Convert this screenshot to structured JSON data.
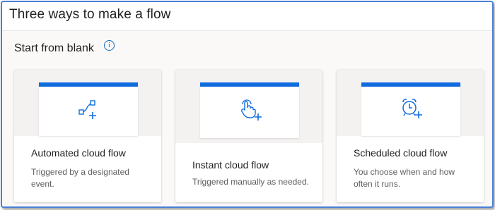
{
  "header": {
    "title": "Three ways to make a flow"
  },
  "section": {
    "title": "Start from blank",
    "info_icon": "info-icon",
    "info_glyph": "i"
  },
  "cards": [
    {
      "title": "Automated cloud flow",
      "description": "Triggered by a designated event.",
      "icon": "automated-flow-icon"
    },
    {
      "title": "Instant cloud flow",
      "description": "Triggered manually as needed.",
      "icon": "tap-hand-icon"
    },
    {
      "title": "Scheduled cloud flow",
      "description": "You choose when and how often it runs.",
      "icon": "alarm-clock-icon"
    }
  ],
  "colors": {
    "accent": "#0f6cdf",
    "frame_border": "#4a7fd6"
  }
}
